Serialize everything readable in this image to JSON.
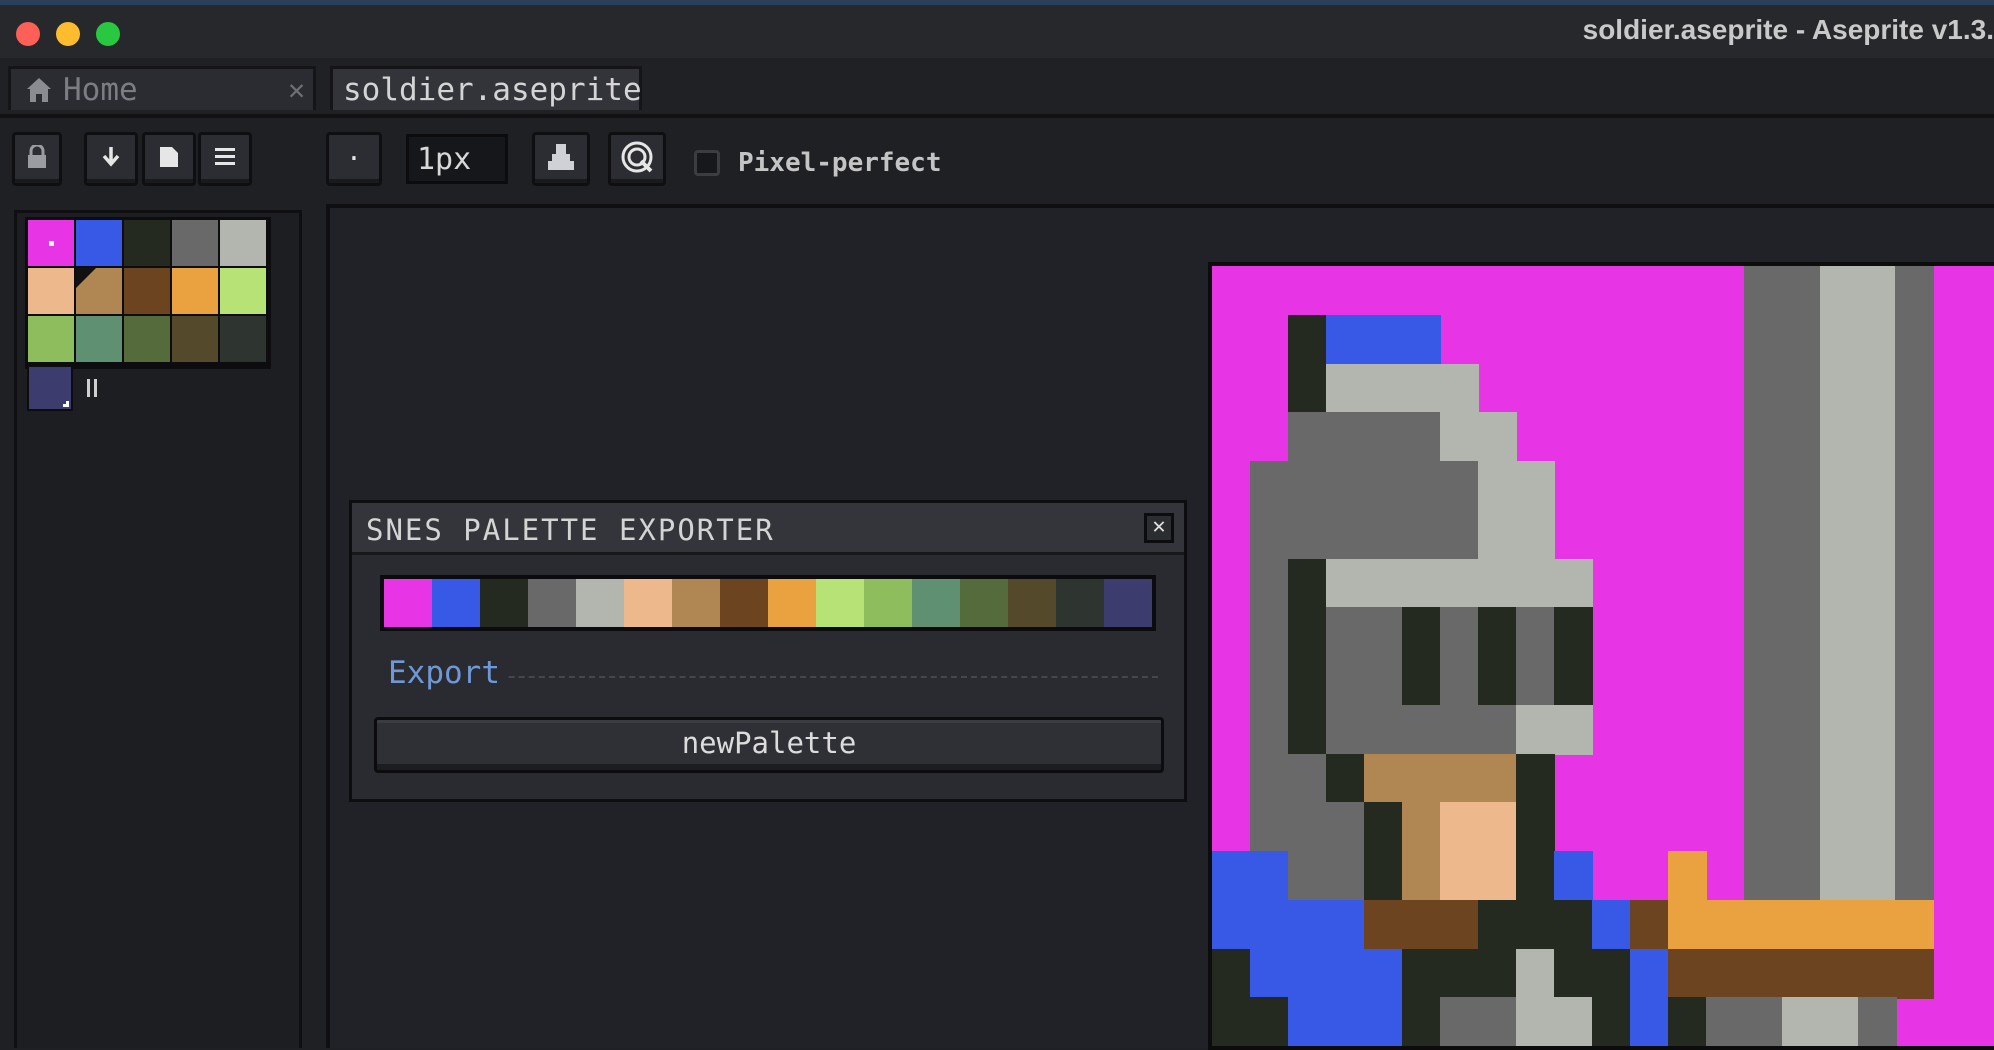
{
  "window": {
    "title": "soldier.aseprite - Aseprite v1.3."
  },
  "tabs": [
    {
      "label": "Home",
      "icon": "home-icon",
      "close": "✕"
    },
    {
      "label": "soldier.aseprite",
      "modified": true
    }
  ],
  "toolbar": {
    "brush_type": "·",
    "brush_size": "1px",
    "pixel_perfect_label": "Pixel-perfect",
    "pixel_perfect_checked": false
  },
  "palette": {
    "colors": [
      "#e734e5",
      "#3859e6",
      "#242a1f",
      "#696969",
      "#b3b6af",
      "#edb88c",
      "#b08752",
      "#6c4420",
      "#e9a23f",
      "#b6e276",
      "#8dbd5d",
      "#5e9071",
      "#566b3c",
      "#54492a",
      "#2e342f"
    ],
    "extra_color": "#3d3c6e",
    "foreground_index": 0,
    "background_index": 6
  },
  "dialog": {
    "title": "SNES PALETTE EXPORTER",
    "close": "✕",
    "palette": [
      "#e734e5",
      "#3859e6",
      "#242a1f",
      "#696969",
      "#b3b6af",
      "#edb88c",
      "#b08752",
      "#6c4420",
      "#e9a23f",
      "#b6e276",
      "#8dbd5d",
      "#5e9071",
      "#566b3c",
      "#54492a",
      "#2e342f",
      "#3d3c6e"
    ],
    "section_label": "Export",
    "button_label": "newPalette"
  }
}
